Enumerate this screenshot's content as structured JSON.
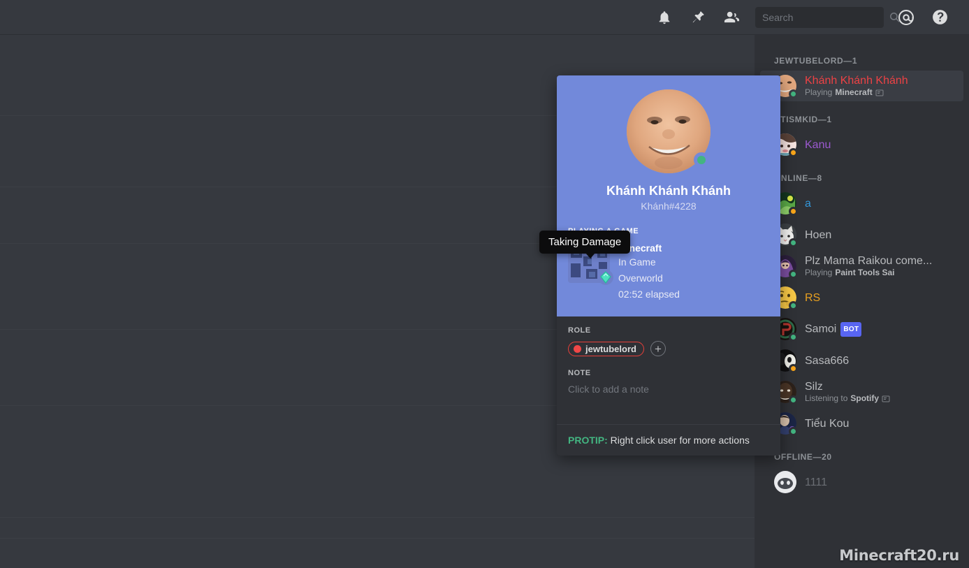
{
  "toolbar": {
    "icons": [
      {
        "name": "bell-icon",
        "label": "Notification Settings"
      },
      {
        "name": "pin-icon",
        "label": "Pinned Messages"
      },
      {
        "name": "members-icon",
        "label": "Member List"
      }
    ],
    "trailing_icons": [
      {
        "name": "mentions-icon",
        "label": "Mentions"
      },
      {
        "name": "help-icon",
        "label": "Help"
      }
    ]
  },
  "search": {
    "placeholder": "Search",
    "value": "",
    "icon": "search-icon"
  },
  "member_list": {
    "groups": [
      {
        "header": "JEWTUBELORD—1",
        "members": [
          {
            "name": "Khánh Khánh Khánh",
            "name_color": "#ed4245",
            "status": "online",
            "activity_prefix": "Playing ",
            "activity_name": "Minecraft",
            "has_rich_presence_icon": true,
            "active": true,
            "avatar": "face-photo"
          }
        ]
      },
      {
        "header": "UTISMKID—1",
        "members": [
          {
            "name": "Kanu",
            "name_color": "#9b59d0",
            "status": "idle",
            "activity_prefix": "",
            "activity_name": "",
            "has_rich_presence_icon": false,
            "active": false,
            "avatar": "anime-girl"
          }
        ]
      },
      {
        "header": "ONLINE—8",
        "members": [
          {
            "name": "a",
            "name_color": "#3498db",
            "status": "idle",
            "activity_prefix": "",
            "activity_name": "",
            "has_rich_presence_icon": false,
            "active": false,
            "avatar": "green-art"
          },
          {
            "name": "Hoen",
            "name_color": "#b9bbbe",
            "status": "online",
            "activity_prefix": "",
            "activity_name": "",
            "has_rich_presence_icon": false,
            "active": false,
            "avatar": "white-cat"
          },
          {
            "name": "Plz Mama Raikou come...",
            "name_color": "#b9bbbe",
            "status": "online",
            "activity_prefix": "Playing ",
            "activity_name": "Paint Tools Sai",
            "has_rich_presence_icon": false,
            "active": false,
            "avatar": "purple-anime"
          },
          {
            "name": "RS",
            "name_color": "#e8a020",
            "status": "online",
            "activity_prefix": "",
            "activity_name": "",
            "has_rich_presence_icon": false,
            "active": false,
            "avatar": "thinking-emoji"
          },
          {
            "name": "Samoi",
            "name_color": "#b9bbbe",
            "status": "online",
            "badge": "BOT",
            "activity_prefix": "",
            "activity_name": "",
            "has_rich_presence_icon": false,
            "active": false,
            "avatar": "dark-red"
          },
          {
            "name": "Sasa666",
            "name_color": "#b9bbbe",
            "status": "idle",
            "activity_prefix": "",
            "activity_name": "",
            "has_rich_presence_icon": false,
            "active": false,
            "avatar": "dark-photo"
          },
          {
            "name": "Silz",
            "name_color": "#b9bbbe",
            "status": "online",
            "activity_prefix": "Listening to ",
            "activity_name": "Spotify",
            "has_rich_presence_icon": true,
            "active": false,
            "avatar": "dark-face"
          },
          {
            "name": "Tiểu Kou",
            "name_color": "#b9bbbe",
            "status": "online",
            "activity_prefix": "",
            "activity_name": "",
            "has_rich_presence_icon": false,
            "active": false,
            "avatar": "blue-photo"
          }
        ]
      },
      {
        "header": "OFFLINE—20",
        "members": [
          {
            "name": "1111",
            "name_color": "#6b6e74",
            "status": "offline",
            "activity_prefix": "",
            "activity_name": "",
            "has_rich_presence_icon": false,
            "active": false,
            "avatar": "default-discord"
          }
        ]
      }
    ]
  },
  "profile_card": {
    "username": "Khánh Khánh Khánh",
    "tag": "Khánh#4228",
    "status": "online",
    "header_color": "#7289da",
    "activity": {
      "section_label": "PLAYING A GAME",
      "game_name": "Minecraft",
      "state": "In Game",
      "details": "Overworld",
      "elapsed": "02:52 elapsed",
      "game_icon": "minecraft-icon",
      "small_badge_icon": "diamond-icon"
    },
    "role_section": {
      "label": "ROLE",
      "roles": [
        {
          "name": "jewtubelord",
          "color": "#f04747"
        }
      ],
      "add_label": "+"
    },
    "note_section": {
      "label": "NOTE",
      "placeholder": "Click to add a note",
      "value": ""
    },
    "footer": {
      "prefix": "PROTIP:",
      "text": " Right click user for more actions"
    }
  },
  "tooltip": {
    "text": "Taking Damage"
  },
  "watermark": {
    "text": "Minecraft20.ru"
  },
  "chat": {
    "divider_positions": [
      115,
      217,
      298,
      421,
      530,
      690,
      720
    ]
  }
}
